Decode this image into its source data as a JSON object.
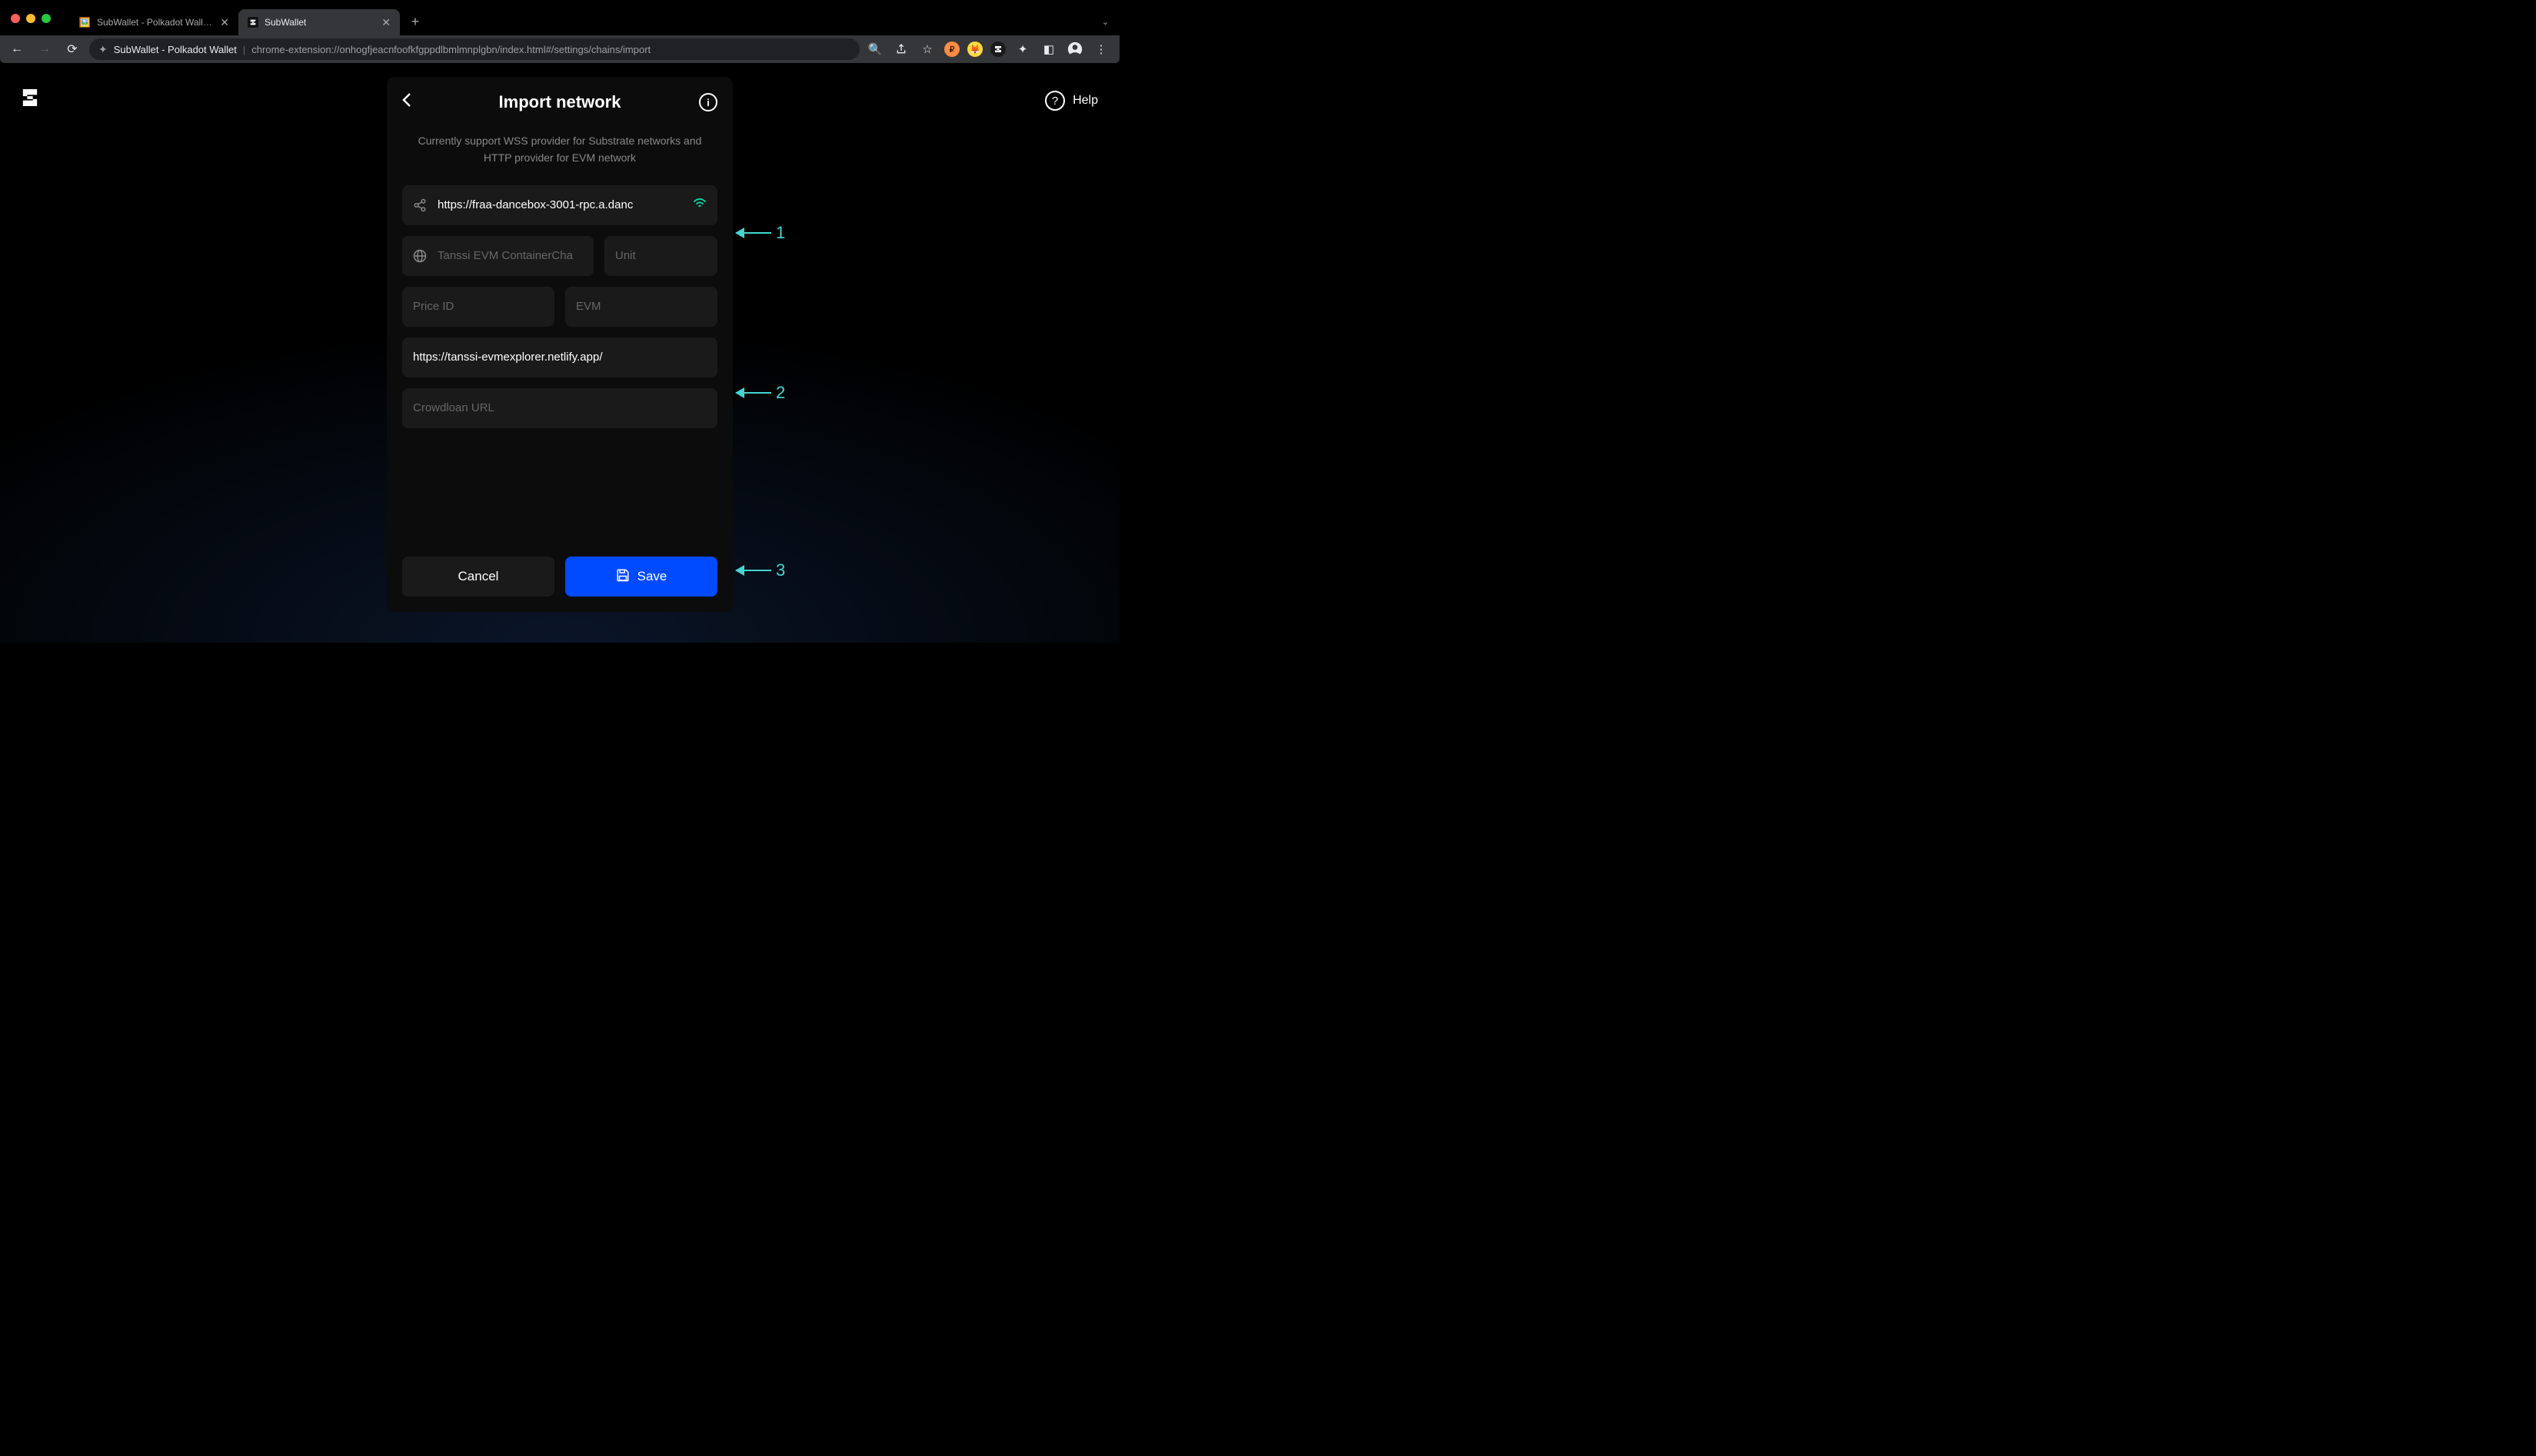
{
  "window": {
    "tabs": [
      {
        "title": "SubWallet - Polkadot Wallet - ",
        "active": false
      },
      {
        "title": "SubWallet",
        "active": true
      }
    ]
  },
  "omnibox": {
    "app_name": "SubWallet - Polkadot Wallet",
    "url": "chrome-extension://onhogfjeacnfoofkfgppdlbmlmnplgbn/index.html#/settings/chains/import"
  },
  "header": {
    "help_label": "Help"
  },
  "panel": {
    "title": "Import network",
    "subtitle": "Currently support WSS provider for Substrate networks and HTTP provider for EVM network",
    "fields": {
      "provider_url": "https://fraa-dancebox-3001-rpc.a.danc",
      "chain_name": "Tanssi EVM ContainerCha",
      "symbol_placeholder": "Unit",
      "price_id_placeholder": "Price ID",
      "chain_type": "EVM",
      "block_explorer": "https://tanssi-evmexplorer.netlify.app/",
      "crowdloan_placeholder": "Crowdloan URL"
    },
    "actions": {
      "cancel": "Cancel",
      "save": "Save"
    }
  },
  "annotations": {
    "a1": "1",
    "a2": "2",
    "a3": "3"
  }
}
